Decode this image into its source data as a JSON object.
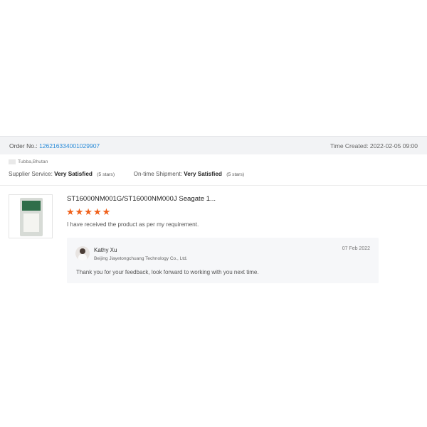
{
  "order": {
    "label": "Order No.:",
    "number": "126216334001029907",
    "time_created": "Time Created: 2022-02-05 09:00"
  },
  "buyer": {
    "location": "Tubba,Bhutan"
  },
  "ratings": {
    "supplier_label": "Supplier Service:",
    "supplier_value": "Very Satisfied",
    "supplier_stars": "(5 stars)",
    "shipment_label": "On-time Shipment:",
    "shipment_value": "Very Satisfied",
    "shipment_stars": "(5 stars)"
  },
  "product": {
    "title": "ST16000NM001G/ST16000NM000J Seagate 1...",
    "rating": 5,
    "stars": "★★★★★",
    "review": "I have received the product as per my requirement."
  },
  "reply": {
    "name": "Kathy Xu",
    "company": "Beijing Jiayetongchuang Technology Co., Ltd.",
    "date": "07 Feb 2022",
    "text": "Thank you for your feedback, look forward to working with you next time."
  },
  "colors": {
    "link": "#2a8bd8",
    "star": "#f0611b",
    "bar_bg": "#f2f3f5"
  }
}
